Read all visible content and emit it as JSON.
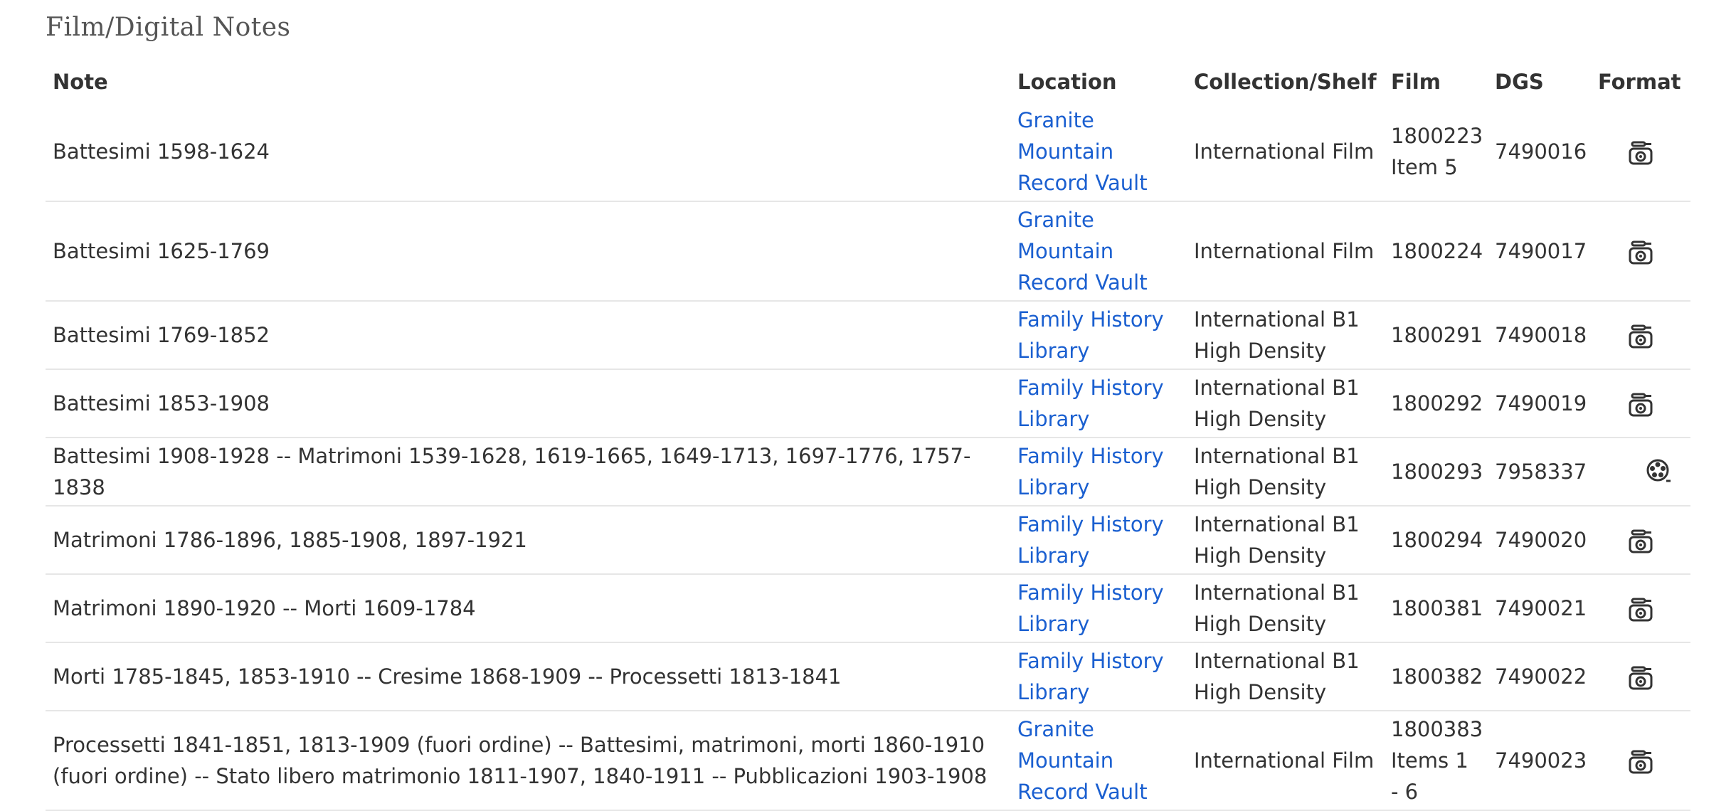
{
  "section_title": "Film/Digital Notes",
  "columns": {
    "note": "Note",
    "location": "Location",
    "collection": "Collection/Shelf",
    "film": "Film",
    "dgs": "DGS",
    "format": "Format"
  },
  "rows": [
    {
      "note": "Battesimi 1598-1624",
      "location": "Granite Mountain Record Vault",
      "collection": "International Film",
      "film": "1800223 Item 5",
      "dgs": "7490016",
      "format_icon": "film-camera-icon"
    },
    {
      "note": "Battesimi 1625-1769",
      "location": "Granite Mountain Record Vault",
      "collection": "International Film",
      "film": "1800224",
      "dgs": "7490017",
      "format_icon": "film-camera-icon"
    },
    {
      "note": "Battesimi 1769-1852",
      "location": "Family History Library",
      "collection": "International B1 High Density",
      "film": "1800291",
      "dgs": "7490018",
      "format_icon": "film-camera-icon"
    },
    {
      "note": "Battesimi 1853-1908",
      "location": "Family History Library",
      "collection": "International B1 High Density",
      "film": "1800292",
      "dgs": "7490019",
      "format_icon": "film-camera-icon"
    },
    {
      "note": "Battesimi 1908-1928 -- Matrimoni 1539-1628, 1619-1665, 1649-1713, 1697-1776, 1757-1838",
      "location": "Family History Library",
      "collection": "International B1 High Density",
      "film": "1800293",
      "dgs": "7958337",
      "format_icon": "film-reel-icon"
    },
    {
      "note": "Matrimoni 1786-1896, 1885-1908, 1897-1921",
      "location": "Family History Library",
      "collection": "International B1 High Density",
      "film": "1800294",
      "dgs": "7490020",
      "format_icon": "film-camera-icon"
    },
    {
      "note": "Matrimoni 1890-1920 -- Morti 1609-1784",
      "location": "Family History Library",
      "collection": "International B1 High Density",
      "film": "1800381",
      "dgs": "7490021",
      "format_icon": "film-camera-icon"
    },
    {
      "note": "Morti 1785-1845, 1853-1910 -- Cresime 1868-1909 -- Processetti 1813-1841",
      "location": "Family History Library",
      "collection": "International B1 High Density",
      "film": "1800382",
      "dgs": "7490022",
      "format_icon": "film-camera-icon"
    },
    {
      "note": "Processetti 1841-1851, 1813-1909 (fuori ordine) -- Battesimi, matrimoni, morti 1860-1910 (fuori ordine) -- Stato libero matrimonio 1811-1907, 1840-1911 -- Pubblicazioni 1903-1908",
      "location": "Granite Mountain Record Vault",
      "collection": "International Film",
      "film": "1800383 Items 1 - 6",
      "dgs": "7490023",
      "format_icon": "film-camera-icon"
    }
  ],
  "colors": {
    "link": "#1a5fd0",
    "text": "#333333",
    "heading": "#555555",
    "divider": "#e6e6e6"
  }
}
